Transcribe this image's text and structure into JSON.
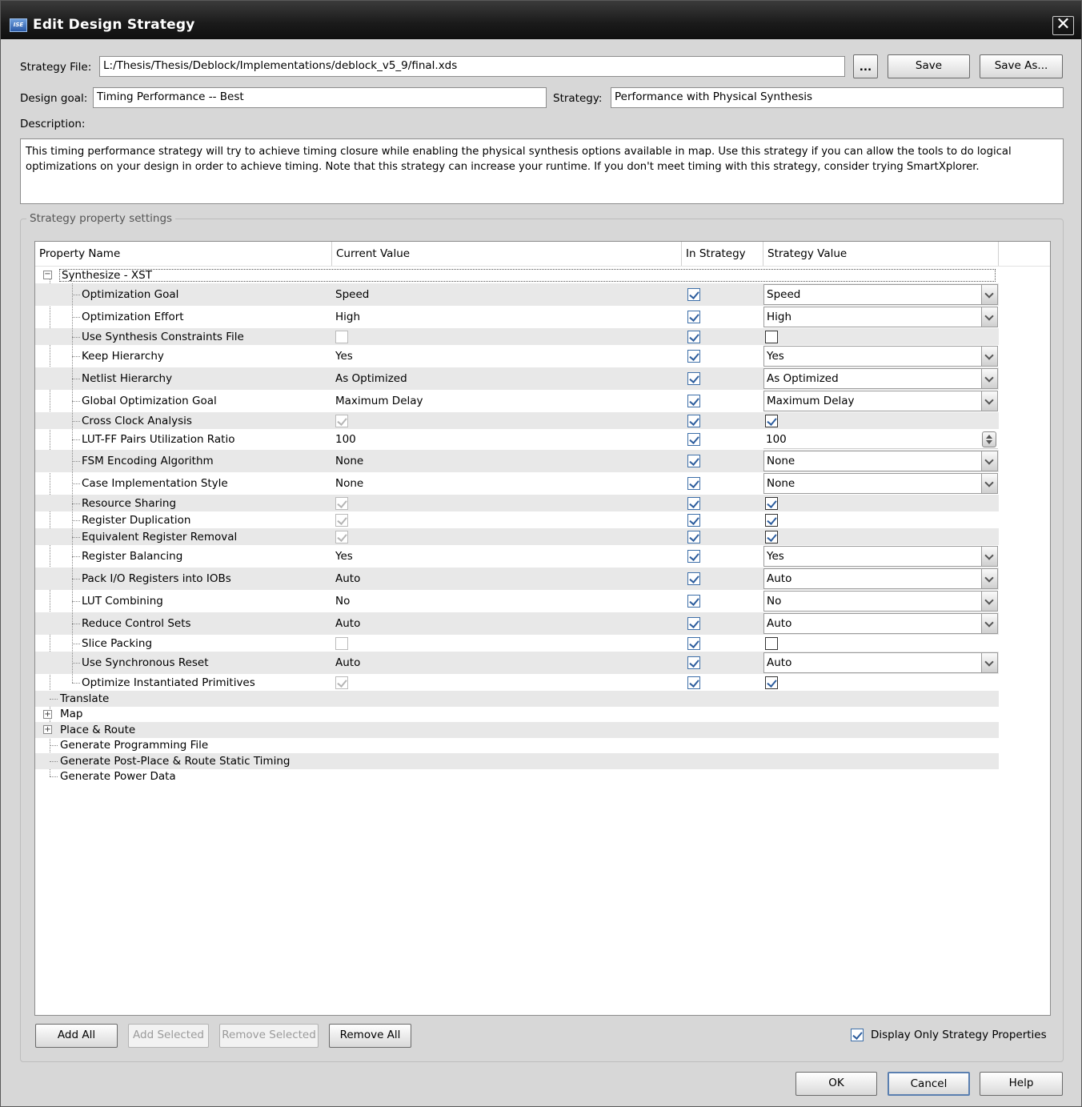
{
  "window": {
    "title": "Edit Design Strategy",
    "app_icon_text": "ISE"
  },
  "strategy_file": {
    "label": "Strategy File:",
    "value": "L:/Thesis/Thesis/Deblock/Implementations/deblock_v5_9/final.xds",
    "browse_label": "...",
    "save_label": "Save",
    "save_as_label": "Save As..."
  },
  "design_goal": {
    "label": "Design goal:",
    "value": "Timing Performance -- Best"
  },
  "strategy": {
    "label": "Strategy:",
    "value": "Performance with Physical Synthesis"
  },
  "description": {
    "label": "Description:",
    "text": "This timing performance strategy will try to achieve timing closure while enabling the physical synthesis options available in map.  Use this strategy if you can allow the tools to do logical optimizations on your design in order to achieve timing.  Note that this strategy can increase your runtime.  If you don't meet timing with this strategy, consider trying SmartXplorer."
  },
  "settings_group": {
    "title": "Strategy property settings"
  },
  "table": {
    "headers": [
      "Property Name",
      "Current Value",
      "In Strategy",
      "Strategy Value"
    ],
    "root": {
      "label": "Synthesize - XST",
      "expanded": true
    },
    "properties": [
      {
        "name": "Optimization Goal",
        "current": "Speed",
        "in_strategy": true,
        "strategy_value": "Speed",
        "control": "dropdown"
      },
      {
        "name": "Optimization Effort",
        "current": "High",
        "in_strategy": true,
        "strategy_value": "High",
        "control": "dropdown"
      },
      {
        "name": "Use Synthesis Constraints File",
        "current_check": false,
        "in_strategy": true,
        "strategy_check": false,
        "control": "checkbox"
      },
      {
        "name": "Keep Hierarchy",
        "current": "Yes",
        "in_strategy": true,
        "strategy_value": "Yes",
        "control": "dropdown"
      },
      {
        "name": "Netlist Hierarchy",
        "current": "As Optimized",
        "in_strategy": true,
        "strategy_value": "As Optimized",
        "control": "dropdown"
      },
      {
        "name": "Global Optimization Goal",
        "current": "Maximum Delay",
        "in_strategy": true,
        "strategy_value": "Maximum Delay",
        "control": "dropdown"
      },
      {
        "name": "Cross Clock Analysis",
        "current_check": true,
        "in_strategy": true,
        "strategy_check": true,
        "control": "checkbox"
      },
      {
        "name": "LUT-FF Pairs Utilization Ratio",
        "current": "100",
        "in_strategy": true,
        "strategy_value": "100",
        "control": "spinner"
      },
      {
        "name": "FSM Encoding Algorithm",
        "current": "None",
        "in_strategy": true,
        "strategy_value": "None",
        "control": "dropdown"
      },
      {
        "name": "Case Implementation Style",
        "current": "None",
        "in_strategy": true,
        "strategy_value": "None",
        "control": "dropdown"
      },
      {
        "name": "Resource Sharing",
        "current_check": true,
        "in_strategy": true,
        "strategy_check": true,
        "control": "checkbox"
      },
      {
        "name": "Register Duplication",
        "current_check": true,
        "in_strategy": true,
        "strategy_check": true,
        "control": "checkbox"
      },
      {
        "name": "Equivalent Register Removal",
        "current_check": true,
        "in_strategy": true,
        "strategy_check": true,
        "control": "checkbox"
      },
      {
        "name": "Register Balancing",
        "current": "Yes",
        "in_strategy": true,
        "strategy_value": "Yes",
        "control": "dropdown"
      },
      {
        "name": "Pack I/O Registers into IOBs",
        "current": "Auto",
        "in_strategy": true,
        "strategy_value": "Auto",
        "control": "dropdown"
      },
      {
        "name": "LUT Combining",
        "current": "No",
        "in_strategy": true,
        "strategy_value": "No",
        "control": "dropdown"
      },
      {
        "name": "Reduce Control Sets",
        "current": "Auto",
        "in_strategy": true,
        "strategy_value": "Auto",
        "control": "dropdown"
      },
      {
        "name": "Slice Packing",
        "current_check": false,
        "in_strategy": true,
        "strategy_check": false,
        "control": "checkbox"
      },
      {
        "name": "Use Synchronous Reset",
        "current": "Auto",
        "in_strategy": true,
        "strategy_value": "Auto",
        "control": "dropdown"
      },
      {
        "name": "Optimize Instantiated Primitives",
        "current_check": true,
        "in_strategy": true,
        "strategy_check": true,
        "control": "checkbox"
      }
    ],
    "processes": [
      {
        "label": "Translate",
        "expandable": false
      },
      {
        "label": "Map",
        "expandable": true
      },
      {
        "label": "Place & Route",
        "expandable": true
      },
      {
        "label": "Generate Programming File",
        "expandable": false
      },
      {
        "label": "Generate Post-Place & Route Static Timing",
        "expandable": false
      },
      {
        "label": "Generate Power Data",
        "expandable": false
      }
    ]
  },
  "actions": {
    "add_all": "Add All",
    "add_selected": "Add Selected",
    "remove_selected": "Remove Selected",
    "remove_all": "Remove All"
  },
  "display_only": {
    "label": "Display Only Strategy Properties",
    "checked": true
  },
  "footer": {
    "ok": "OK",
    "cancel": "Cancel",
    "help": "Help"
  }
}
